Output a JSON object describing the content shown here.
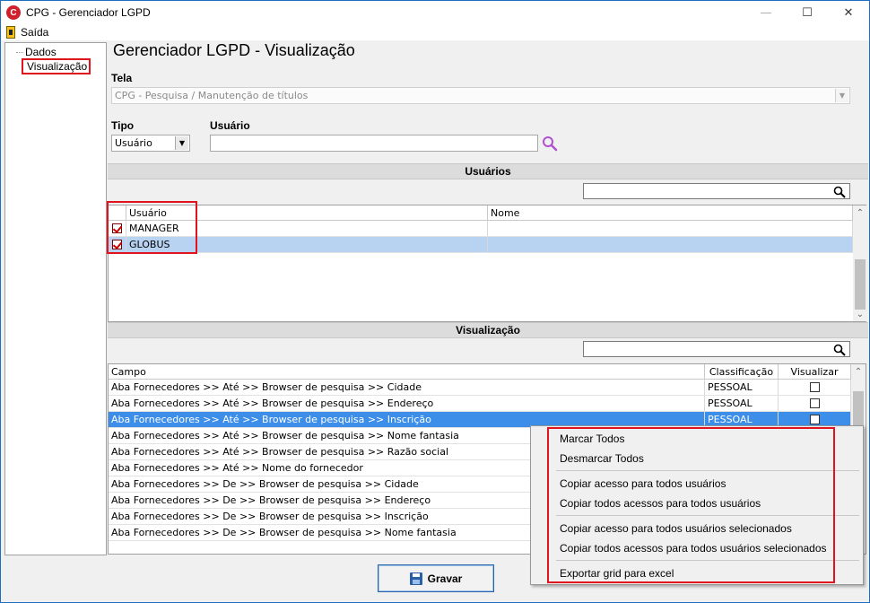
{
  "window": {
    "title": "CPG - Gerenciador LGPD",
    "icon": "C",
    "minimize": "—",
    "maximize": "☐",
    "close": "✕"
  },
  "menu": {
    "exit_label": "Saída"
  },
  "tree": {
    "items": [
      "Dados",
      "Visualização"
    ]
  },
  "page": {
    "title": "Gerenciador LGPD - Visualização"
  },
  "tela": {
    "label": "Tela",
    "value": "CPG - Pesquisa / Manutenção de títulos"
  },
  "tipo": {
    "label": "Tipo",
    "value": "Usuário"
  },
  "usuario": {
    "label": "Usuário",
    "value": ""
  },
  "users_section": {
    "header": "Usuários",
    "columns": [
      "Usuário",
      "Nome"
    ],
    "rows": [
      {
        "checked": true,
        "user": "MANAGER",
        "name": ""
      },
      {
        "checked": true,
        "user": "GLOBUS",
        "name": ""
      }
    ]
  },
  "view_section": {
    "header": "Visualização",
    "columns": [
      "Campo",
      "Classificação",
      "Visualizar"
    ],
    "rows": [
      {
        "campo": "Aba Fornecedores >> Até >> Browser de pesquisa >> Cidade",
        "class": "PESSOAL"
      },
      {
        "campo": "Aba Fornecedores >> Até >> Browser de pesquisa >> Endereço",
        "class": "PESSOAL"
      },
      {
        "campo": "Aba Fornecedores >> Até >> Browser de pesquisa >> Inscrição",
        "class": "PESSOAL"
      },
      {
        "campo": "Aba Fornecedores >> Até >> Browser de pesquisa >> Nome fantasia",
        "class": ""
      },
      {
        "campo": "Aba Fornecedores >> Até >> Browser de pesquisa >> Razão social",
        "class": ""
      },
      {
        "campo": "Aba Fornecedores >> Até >> Nome do fornecedor",
        "class": ""
      },
      {
        "campo": "Aba Fornecedores >> De >> Browser de pesquisa >> Cidade",
        "class": ""
      },
      {
        "campo": "Aba Fornecedores >> De >> Browser de pesquisa >> Endereço",
        "class": ""
      },
      {
        "campo": "Aba Fornecedores >> De >> Browser de pesquisa >> Inscrição",
        "class": ""
      },
      {
        "campo": "Aba Fornecedores >> De >> Browser de pesquisa >> Nome fantasia",
        "class": ""
      }
    ]
  },
  "save_button": {
    "label": "Gravar"
  },
  "context_menu": {
    "items": [
      "Marcar Todos",
      "Desmarcar Todos",
      "Copiar acesso para todos usuários",
      "Copiar todos acessos para todos usuários",
      "Copiar acesso para todos usuários selecionados",
      "Copiar todos acessos para todos usuários selecionados",
      "Exportar grid para excel"
    ]
  },
  "colors": {
    "selection": "#3c8ee8",
    "highlight_frame": "#e0141e",
    "section_header": "#dcdcdc"
  },
  "icons": {
    "search": "magnifier-icon",
    "lookup": "purple-search-icon",
    "save": "floppy-icon",
    "exit": "exit-door-icon"
  }
}
